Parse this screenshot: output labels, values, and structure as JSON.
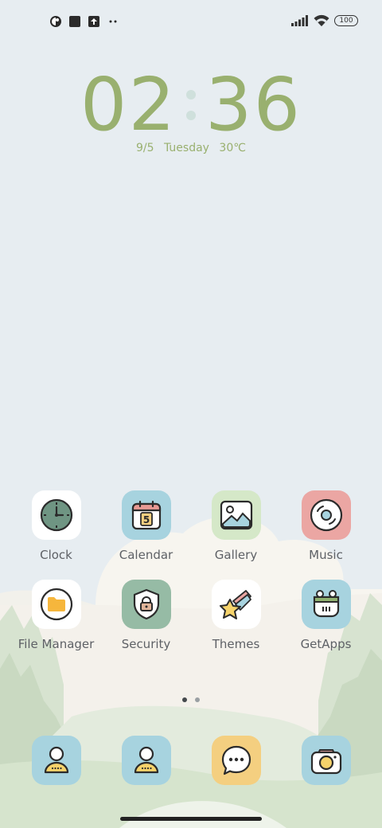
{
  "status_bar": {
    "left_icons": [
      "app-notification-icon",
      "square-notification-icon",
      "upload-notification-icon",
      "more-dots-icon"
    ],
    "right_icons": [
      "signal-icon",
      "wifi-icon",
      "battery-icon"
    ],
    "battery": "100"
  },
  "clock": {
    "hour": "02",
    "minute": "36",
    "date": "9/5",
    "weekday": "Tuesday",
    "temperature": "30℃"
  },
  "apps": [
    {
      "label": "Clock",
      "bg": "#ffffff",
      "icon": "clock-icon"
    },
    {
      "label": "Calendar",
      "bg": "#a7d3df",
      "icon": "calendar-icon",
      "calendar_day": "5"
    },
    {
      "label": "Gallery",
      "bg": "#d5e8c8",
      "icon": "gallery-icon"
    },
    {
      "label": "Music",
      "bg": "#eba6a3",
      "icon": "music-icon"
    },
    {
      "label": "File Manager",
      "bg": "#ffffff",
      "icon": "folder-icon"
    },
    {
      "label": "Security",
      "bg": "#96bba5",
      "icon": "shield-lock-icon"
    },
    {
      "label": "Themes",
      "bg": "#ffffff",
      "icon": "shooting-star-icon"
    },
    {
      "label": "GetApps",
      "bg": "#a7d3df",
      "icon": "getapps-icon"
    }
  ],
  "dock": [
    {
      "name": "dock-contacts",
      "bg": "#a7d3df",
      "icon": "contact-icon"
    },
    {
      "name": "dock-phone",
      "bg": "#a7d3df",
      "icon": "contact-icon"
    },
    {
      "name": "dock-messages",
      "bg": "#f4cf80",
      "icon": "chat-bubble-icon"
    },
    {
      "name": "dock-camera",
      "bg": "#a7d3df",
      "icon": "camera-icon"
    }
  ],
  "pages": {
    "count": 2,
    "current": 1
  },
  "colors": {
    "accent": "#99b06f",
    "background": "#e7edf1"
  }
}
